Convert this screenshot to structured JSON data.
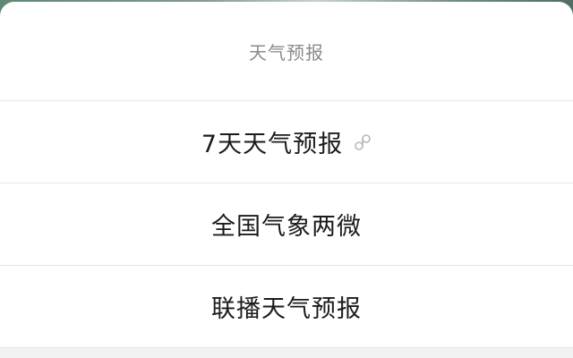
{
  "sheet": {
    "title": "天气预报",
    "items": [
      {
        "label": "7天天气预报",
        "icon": "mini-program-link-icon"
      },
      {
        "label": "全国气象两微"
      },
      {
        "label": "联播天气预报"
      }
    ]
  }
}
